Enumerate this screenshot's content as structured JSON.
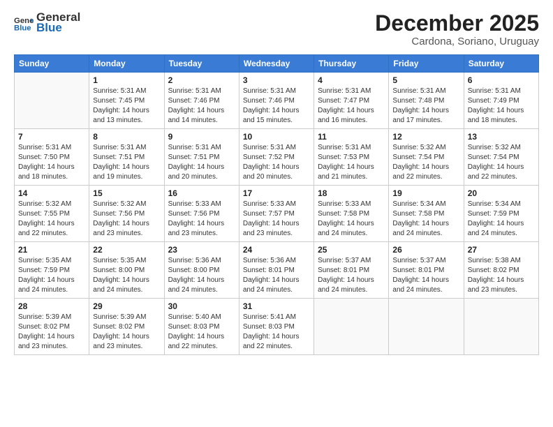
{
  "header": {
    "logo_general": "General",
    "logo_blue": "Blue",
    "month_title": "December 2025",
    "location": "Cardona, Soriano, Uruguay"
  },
  "weekdays": [
    "Sunday",
    "Monday",
    "Tuesday",
    "Wednesday",
    "Thursday",
    "Friday",
    "Saturday"
  ],
  "weeks": [
    [
      {
        "day": "",
        "info": ""
      },
      {
        "day": "1",
        "info": "Sunrise: 5:31 AM\nSunset: 7:45 PM\nDaylight: 14 hours\nand 13 minutes."
      },
      {
        "day": "2",
        "info": "Sunrise: 5:31 AM\nSunset: 7:46 PM\nDaylight: 14 hours\nand 14 minutes."
      },
      {
        "day": "3",
        "info": "Sunrise: 5:31 AM\nSunset: 7:46 PM\nDaylight: 14 hours\nand 15 minutes."
      },
      {
        "day": "4",
        "info": "Sunrise: 5:31 AM\nSunset: 7:47 PM\nDaylight: 14 hours\nand 16 minutes."
      },
      {
        "day": "5",
        "info": "Sunrise: 5:31 AM\nSunset: 7:48 PM\nDaylight: 14 hours\nand 17 minutes."
      },
      {
        "day": "6",
        "info": "Sunrise: 5:31 AM\nSunset: 7:49 PM\nDaylight: 14 hours\nand 18 minutes."
      }
    ],
    [
      {
        "day": "7",
        "info": "Sunrise: 5:31 AM\nSunset: 7:50 PM\nDaylight: 14 hours\nand 18 minutes."
      },
      {
        "day": "8",
        "info": "Sunrise: 5:31 AM\nSunset: 7:51 PM\nDaylight: 14 hours\nand 19 minutes."
      },
      {
        "day": "9",
        "info": "Sunrise: 5:31 AM\nSunset: 7:51 PM\nDaylight: 14 hours\nand 20 minutes."
      },
      {
        "day": "10",
        "info": "Sunrise: 5:31 AM\nSunset: 7:52 PM\nDaylight: 14 hours\nand 20 minutes."
      },
      {
        "day": "11",
        "info": "Sunrise: 5:31 AM\nSunset: 7:53 PM\nDaylight: 14 hours\nand 21 minutes."
      },
      {
        "day": "12",
        "info": "Sunrise: 5:32 AM\nSunset: 7:54 PM\nDaylight: 14 hours\nand 22 minutes."
      },
      {
        "day": "13",
        "info": "Sunrise: 5:32 AM\nSunset: 7:54 PM\nDaylight: 14 hours\nand 22 minutes."
      }
    ],
    [
      {
        "day": "14",
        "info": "Sunrise: 5:32 AM\nSunset: 7:55 PM\nDaylight: 14 hours\nand 22 minutes."
      },
      {
        "day": "15",
        "info": "Sunrise: 5:32 AM\nSunset: 7:56 PM\nDaylight: 14 hours\nand 23 minutes."
      },
      {
        "day": "16",
        "info": "Sunrise: 5:33 AM\nSunset: 7:56 PM\nDaylight: 14 hours\nand 23 minutes."
      },
      {
        "day": "17",
        "info": "Sunrise: 5:33 AM\nSunset: 7:57 PM\nDaylight: 14 hours\nand 23 minutes."
      },
      {
        "day": "18",
        "info": "Sunrise: 5:33 AM\nSunset: 7:58 PM\nDaylight: 14 hours\nand 24 minutes."
      },
      {
        "day": "19",
        "info": "Sunrise: 5:34 AM\nSunset: 7:58 PM\nDaylight: 14 hours\nand 24 minutes."
      },
      {
        "day": "20",
        "info": "Sunrise: 5:34 AM\nSunset: 7:59 PM\nDaylight: 14 hours\nand 24 minutes."
      }
    ],
    [
      {
        "day": "21",
        "info": "Sunrise: 5:35 AM\nSunset: 7:59 PM\nDaylight: 14 hours\nand 24 minutes."
      },
      {
        "day": "22",
        "info": "Sunrise: 5:35 AM\nSunset: 8:00 PM\nDaylight: 14 hours\nand 24 minutes."
      },
      {
        "day": "23",
        "info": "Sunrise: 5:36 AM\nSunset: 8:00 PM\nDaylight: 14 hours\nand 24 minutes."
      },
      {
        "day": "24",
        "info": "Sunrise: 5:36 AM\nSunset: 8:01 PM\nDaylight: 14 hours\nand 24 minutes."
      },
      {
        "day": "25",
        "info": "Sunrise: 5:37 AM\nSunset: 8:01 PM\nDaylight: 14 hours\nand 24 minutes."
      },
      {
        "day": "26",
        "info": "Sunrise: 5:37 AM\nSunset: 8:01 PM\nDaylight: 14 hours\nand 24 minutes."
      },
      {
        "day": "27",
        "info": "Sunrise: 5:38 AM\nSunset: 8:02 PM\nDaylight: 14 hours\nand 23 minutes."
      }
    ],
    [
      {
        "day": "28",
        "info": "Sunrise: 5:39 AM\nSunset: 8:02 PM\nDaylight: 14 hours\nand 23 minutes."
      },
      {
        "day": "29",
        "info": "Sunrise: 5:39 AM\nSunset: 8:02 PM\nDaylight: 14 hours\nand 23 minutes."
      },
      {
        "day": "30",
        "info": "Sunrise: 5:40 AM\nSunset: 8:03 PM\nDaylight: 14 hours\nand 22 minutes."
      },
      {
        "day": "31",
        "info": "Sunrise: 5:41 AM\nSunset: 8:03 PM\nDaylight: 14 hours\nand 22 minutes."
      },
      {
        "day": "",
        "info": ""
      },
      {
        "day": "",
        "info": ""
      },
      {
        "day": "",
        "info": ""
      }
    ]
  ]
}
